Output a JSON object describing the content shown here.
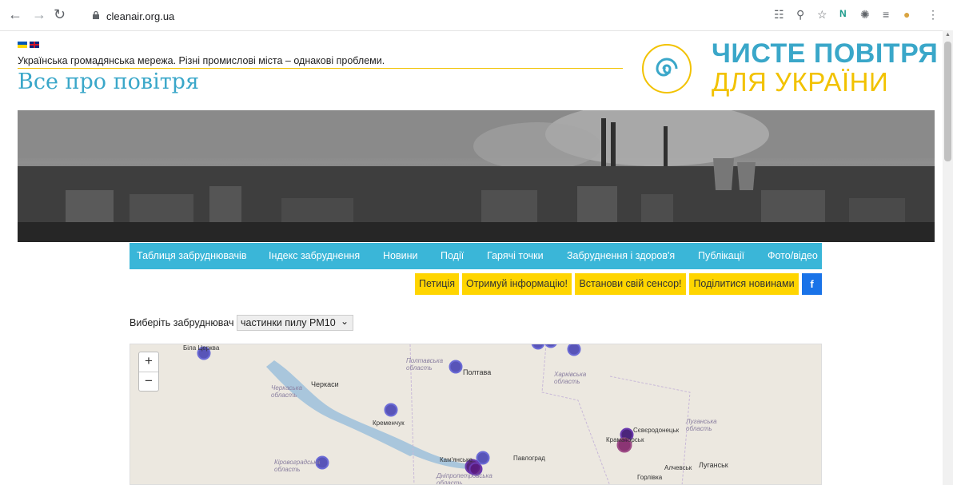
{
  "browser": {
    "url": "cleanair.org.ua",
    "icons": [
      "back-icon",
      "forward-icon",
      "reload-icon",
      "lock-icon",
      "translate-icon",
      "zoom-icon",
      "star-icon",
      "extension-icon",
      "puzzle-icon",
      "reading-list-icon",
      "profile-icon",
      "menu-icon"
    ]
  },
  "header": {
    "tagline": "Українська громадянська мережа. Різні промислові міста – однакові проблеми.",
    "site_title": "Все про повітря",
    "logo_line1": "ЧИСТЕ ПОВІТРЯ",
    "logo_line2": "ДЛЯ УКРАЇНИ"
  },
  "menu": {
    "items": [
      "Таблиця забруднювачів",
      "Індекс забруднення",
      "Новини",
      "Події",
      "Гарячі точки",
      "Забруднення і здоров'я",
      "Публікації",
      "Фото/відео"
    ]
  },
  "actions": {
    "items": [
      "Петиція",
      "Отримуй інформацію!",
      "Встанови свій сенсор!",
      "Поділитися новинами"
    ],
    "facebook": "f"
  },
  "selector": {
    "label": "Виберіть забруднювач",
    "value": "частинки пилу PM10"
  },
  "map": {
    "zoom_in": "+",
    "zoom_out": "−",
    "labels": {
      "bila_tserkva": "Біла Церква",
      "poltavska": "Полтавська область",
      "poltava": "Полтава",
      "kharkivska": "Харківська область",
      "cherkaska": "Черкаська область",
      "cherkasy": "Черкаси",
      "kremenchuk": "Кременчук",
      "luhanska": "Луганська область",
      "sievierodonetsk": "Сєвєродонецьк",
      "kramatorsk": "Краматорськ",
      "kirovohradska": "Кіровоградська область",
      "kamianske": "Кам'янське",
      "pavlohrad": "Павлоград",
      "dnipropetrovska": "Дніпропетровська область",
      "alchevsk": "Алчевськ",
      "luhansk": "Луганськ",
      "horlivka": "Горлівка"
    }
  }
}
